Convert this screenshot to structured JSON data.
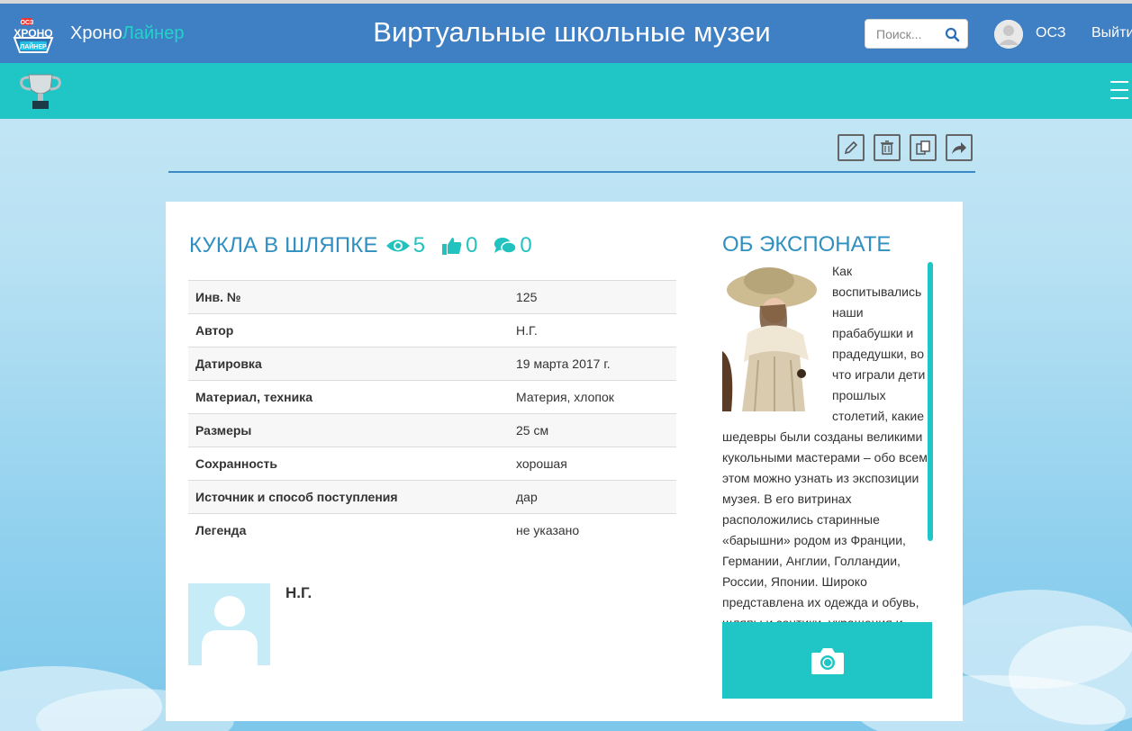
{
  "header": {
    "logo_text": "ОСЗ ХРОНО ЛАЙНЕР",
    "brand_part1": "Хроно",
    "brand_part2": "Лайнер",
    "site_title": "Виртуальные школьные музеи",
    "search_placeholder": "Поиск...",
    "username": "ОСЗ",
    "logout_label": "Выйти"
  },
  "toolbar": {
    "icons": [
      "pencil-icon",
      "trash-icon",
      "copy-icon",
      "share-icon"
    ]
  },
  "exhibit": {
    "title": "КУКЛА В ШЛЯПКЕ",
    "views": "5",
    "likes": "0",
    "comments": "0",
    "attributes": [
      {
        "label": "Инв. №",
        "value": "125"
      },
      {
        "label": "Автор",
        "value": "Н.Г."
      },
      {
        "label": "Датировка",
        "value": "19 марта 2017 г."
      },
      {
        "label": "Материал, техника",
        "value": "Материя, хлопок"
      },
      {
        "label": "Размеры",
        "value": "25 см"
      },
      {
        "label": "Сохранность",
        "value": "хорошая"
      },
      {
        "label": "Источник и способ поступления",
        "value": "дар"
      },
      {
        "label": "Легенда",
        "value": "не указано"
      }
    ],
    "author_name": "Н.Г."
  },
  "about": {
    "title": "ОБ ЭКСПОНАТЕ",
    "text": "Как воспитывались наши прабабушки и прадедушки, во что играли дети прошлых столетий, какие шедевры были созданы великими кукольными мастерами – обо всем этом можно узнать из экспозиции музея. В его витринах расположились старинные «барышни» родом из Франции, Германии, Англии, Голландии, России, Японии. Широко представлена их одежда и обувь, шляпы и зонтики, украшения и"
  },
  "colors": {
    "header_bg": "#3f7fc3",
    "accent": "#1fc6c5",
    "title_blue": "#2f8fc0"
  }
}
